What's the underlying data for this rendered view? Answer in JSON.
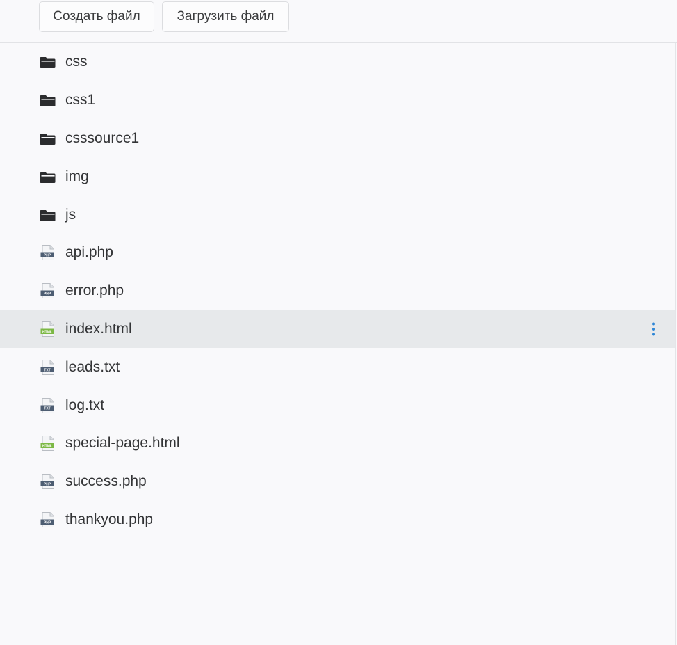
{
  "toolbar": {
    "create_label": "Создать файл",
    "upload_label": "Загрузить файл"
  },
  "files": [
    {
      "name": "css",
      "type": "folder",
      "icon": "folder-icon"
    },
    {
      "name": "css1",
      "type": "folder",
      "icon": "folder-icon"
    },
    {
      "name": "csssource1",
      "type": "folder",
      "icon": "folder-icon"
    },
    {
      "name": "img",
      "type": "folder",
      "icon": "folder-icon"
    },
    {
      "name": "js",
      "type": "folder",
      "icon": "folder-icon"
    },
    {
      "name": "api.php",
      "type": "php",
      "icon": "php-file-icon",
      "badge": "PHP"
    },
    {
      "name": "error.php",
      "type": "php",
      "icon": "php-file-icon",
      "badge": "PHP"
    },
    {
      "name": "index.html",
      "type": "html",
      "icon": "html-file-icon",
      "badge": "HTML",
      "selected": true
    },
    {
      "name": "leads.txt",
      "type": "txt",
      "icon": "txt-file-icon",
      "badge": "TXT"
    },
    {
      "name": "log.txt",
      "type": "txt",
      "icon": "txt-file-icon",
      "badge": "TXT"
    },
    {
      "name": "special-page.html",
      "type": "html",
      "icon": "html-file-icon",
      "badge": "HTML"
    },
    {
      "name": "success.php",
      "type": "php",
      "icon": "php-file-icon",
      "badge": "PHP"
    },
    {
      "name": "thankyou.php",
      "type": "php",
      "icon": "php-file-icon",
      "badge": "PHP"
    }
  ],
  "colors": {
    "folder": "#2b2c2e",
    "php_badge": "#4d5d72",
    "txt_badge": "#4d5d72",
    "html_badge": "#7cb845",
    "menu_dots": "#2e86d6",
    "selected_row": "#e7e9eb"
  }
}
